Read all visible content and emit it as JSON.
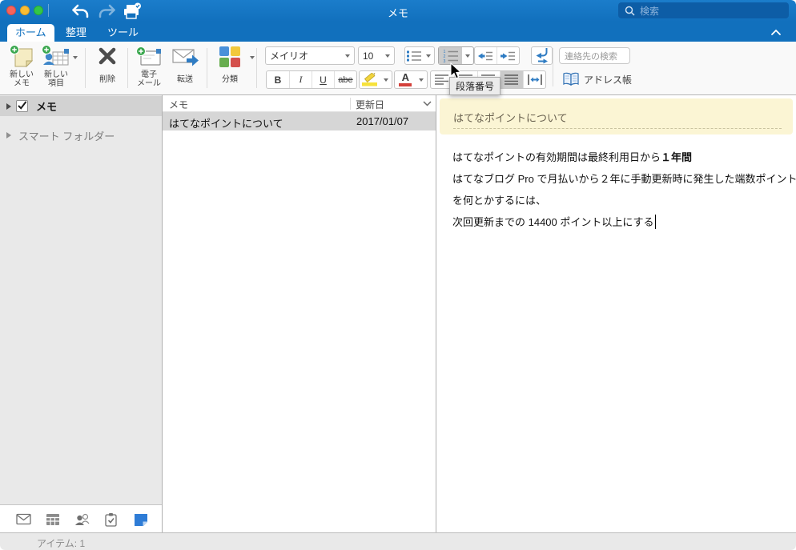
{
  "window": {
    "title": "メモ"
  },
  "titlebar": {
    "search_placeholder": "検索"
  },
  "tabs": {
    "home": "ホーム",
    "organize": "整理",
    "tools": "ツール"
  },
  "ribbon": {
    "new_note": {
      "l1": "新しい",
      "l2": "メモ"
    },
    "new_item": {
      "l1": "新しい",
      "l2": "項目"
    },
    "delete": "削除",
    "email": {
      "l1": "電子",
      "l2": "メール"
    },
    "forward": "転送",
    "categorize": "分類",
    "font_name": "メイリオ",
    "font_size": "10",
    "bold": "B",
    "italic": "I",
    "underline": "U",
    "strikethrough": "abe",
    "font_color_letter": "A",
    "contact_search_placeholder": "連絡先の検索",
    "address_book": "アドレス帳",
    "tooltip": "段落番号"
  },
  "sidebar": {
    "memo": "メモ",
    "smart_folders": "スマート フォルダー"
  },
  "list": {
    "col_title": "メモ",
    "col_date": "更新日",
    "rows": [
      {
        "title": "はてなポイントについて",
        "date": "2017/01/07"
      }
    ]
  },
  "note": {
    "title": "はてなポイントについて",
    "lines": [
      [
        {
          "text": "はてなポイントの有効期間は最終利用日から",
          "bold": false
        },
        {
          "text": "１年間",
          "bold": true
        }
      ],
      [
        {
          "text": "はてなブログ Pro で月払いから２年に手動更新時に発生した端数ポイント",
          "bold": false
        }
      ],
      [
        {
          "text": "を何とかするには、",
          "bold": false
        }
      ],
      [
        {
          "text": "次回更新までの 14400 ポイント以上にする",
          "bold": false
        }
      ]
    ]
  },
  "statusbar": {
    "items": "アイテム: 1"
  },
  "colors": {
    "titlebar_blue": "#1170bd",
    "accent_blue": "#2f7cc3",
    "note_yellow": "#fbf5d4",
    "selection_gray": "#d6d6d6"
  }
}
